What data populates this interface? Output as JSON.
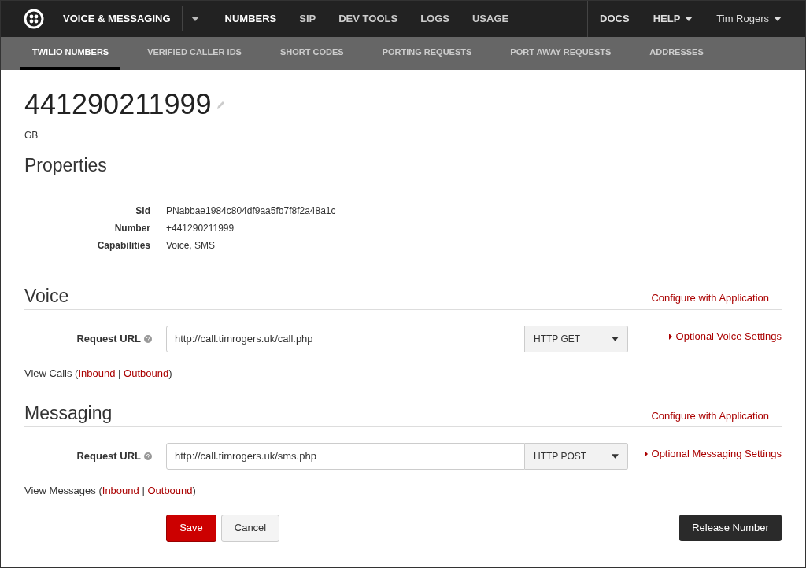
{
  "topnav": {
    "product": "VOICE & MESSAGING",
    "items": [
      {
        "label": "NUMBERS",
        "selected": true
      },
      {
        "label": "SIP",
        "selected": false
      },
      {
        "label": "DEV TOOLS",
        "selected": false
      },
      {
        "label": "LOGS",
        "selected": false
      },
      {
        "label": "USAGE",
        "selected": false
      }
    ],
    "right": [
      {
        "label": "DOCS",
        "dropdown": false
      },
      {
        "label": "HELP",
        "dropdown": true
      },
      {
        "label": "Tim Rogers",
        "dropdown": true
      }
    ]
  },
  "subnav": [
    {
      "label": "TWILIO NUMBERS",
      "selected": true
    },
    {
      "label": "VERIFIED CALLER IDS",
      "selected": false
    },
    {
      "label": "SHORT CODES",
      "selected": false
    },
    {
      "label": "PORTING REQUESTS",
      "selected": false
    },
    {
      "label": "PORT AWAY REQUESTS",
      "selected": false
    },
    {
      "label": "ADDRESSES",
      "selected": false
    }
  ],
  "number": {
    "title": "441290211999",
    "country": "GB"
  },
  "properties": {
    "heading": "Properties",
    "rows": [
      {
        "label": "Sid",
        "value": "PNabbae1984c804df9aa5fb7f8f2a48a1c"
      },
      {
        "label": "Number",
        "value": "+441290211999"
      },
      {
        "label": "Capabilities",
        "value": "Voice, SMS"
      }
    ]
  },
  "sections": [
    {
      "heading": "Voice",
      "configure": "Configure with Application",
      "url_label": "Request URL",
      "url": "http://call.timrogers.uk/call.php",
      "method": "HTTP GET",
      "optional": "Optional Voice Settings",
      "view": {
        "label": "View Calls",
        "open": "(",
        "links": [
          "Inbound",
          "Outbound"
        ],
        "separator": "|",
        "close": ")"
      }
    },
    {
      "heading": "Messaging",
      "configure": "Configure with Application",
      "url_label": "Request URL",
      "url": "http://call.timrogers.uk/sms.php",
      "method": "HTTP POST",
      "optional": "Optional Messaging Settings",
      "view": {
        "label": "View Messages",
        "open": "(",
        "links": [
          "Inbound",
          "Outbound"
        ],
        "separator": "|",
        "close": ")"
      }
    }
  ],
  "buttons": {
    "save": "Save",
    "cancel": "Cancel",
    "release": "Release Number"
  }
}
